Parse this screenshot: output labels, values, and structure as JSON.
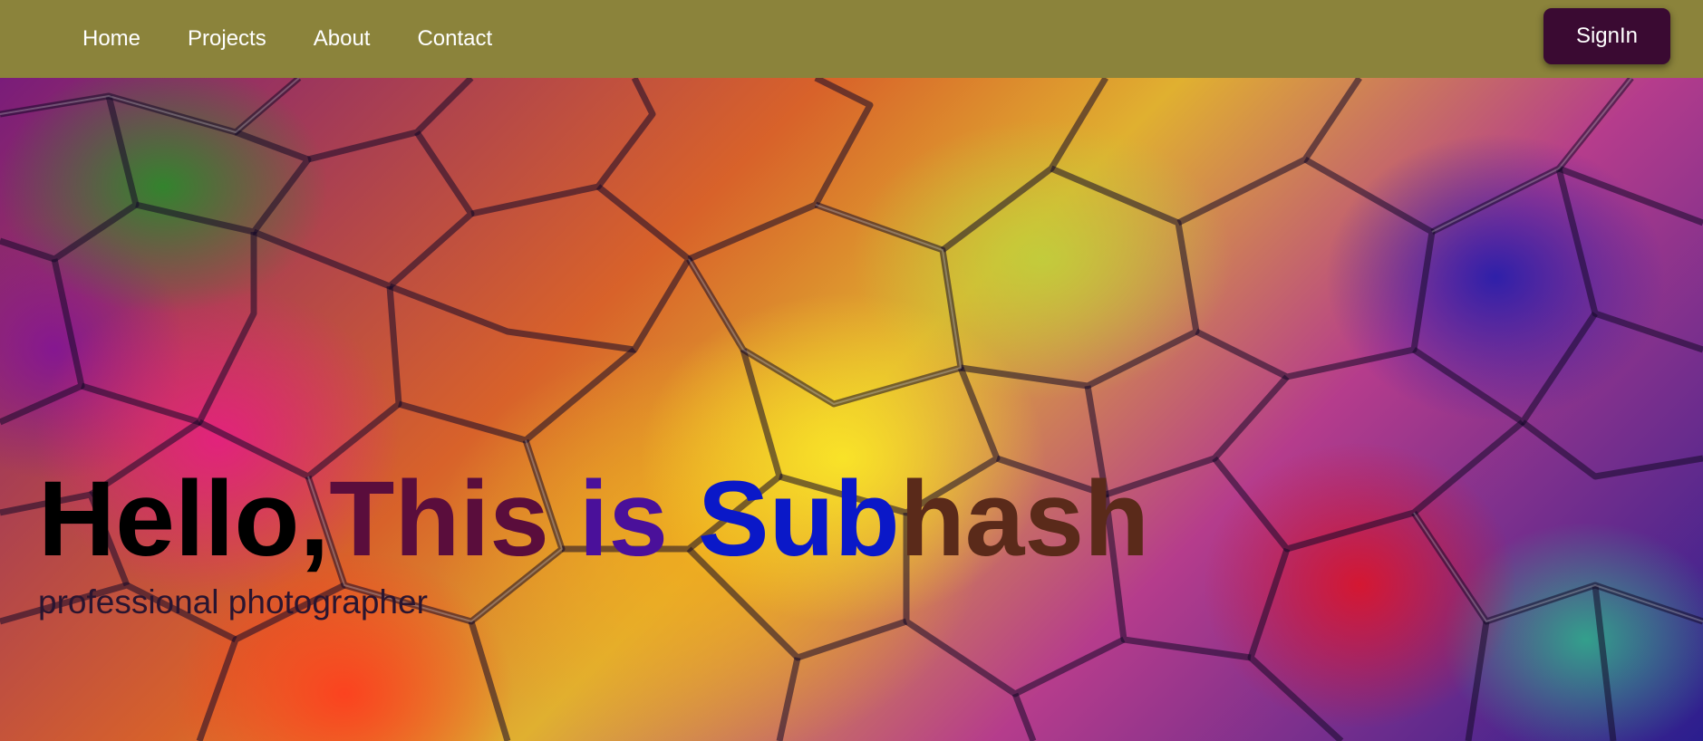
{
  "nav": {
    "items": [
      {
        "label": "Home"
      },
      {
        "label": "Projects"
      },
      {
        "label": "About"
      },
      {
        "label": "Contact"
      }
    ],
    "signin_label": "SignIn"
  },
  "hero": {
    "title_parts": [
      {
        "text": "Hello,",
        "color": "#000000"
      },
      {
        "text": "This",
        "color": "#5a0d3c"
      },
      {
        "text": " is ",
        "color": "#4a109a"
      },
      {
        "text": "Sub",
        "color": "#0a18c8"
      },
      {
        "text": "hash",
        "color": "#5a2a1a"
      }
    ],
    "subtitle": "professional photographer"
  },
  "colors": {
    "navbar_bg": "#8b833b",
    "signin_bg": "#3a0a32",
    "nav_text": "#ffffff"
  }
}
